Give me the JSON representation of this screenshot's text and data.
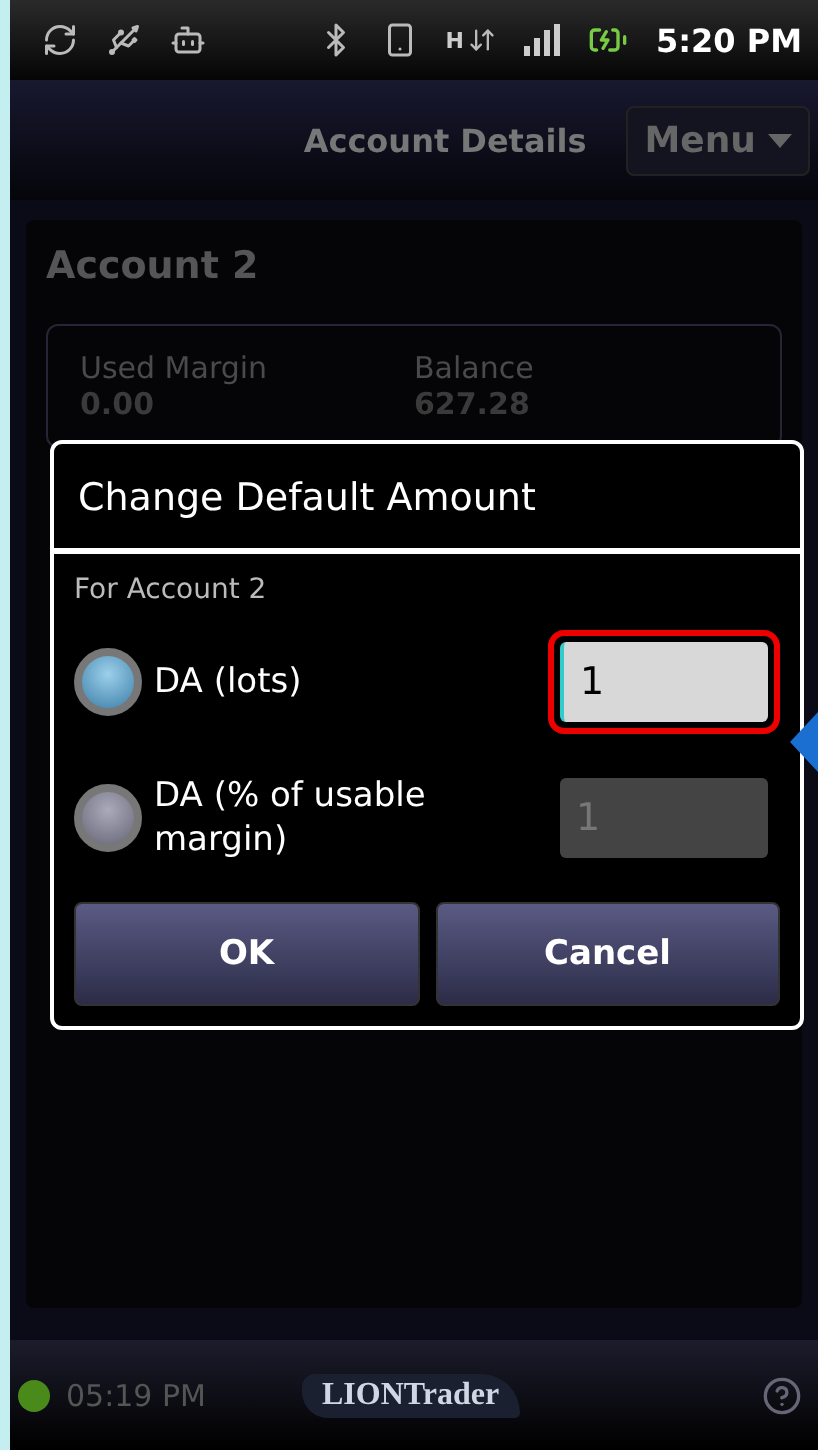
{
  "status_bar": {
    "network": "H",
    "time": "5:20 PM"
  },
  "header": {
    "title": "Account Details",
    "menu": "Menu"
  },
  "account": {
    "name": "Account 2",
    "fields": [
      {
        "label": "Used Margin",
        "value": "0.00"
      },
      {
        "label": "Balance",
        "value": "627.28"
      }
    ]
  },
  "dialog": {
    "title": "Change Default Amount",
    "subtitle": "For Account 2",
    "options": [
      {
        "label": "DA (lots)",
        "selected": true,
        "value": "1",
        "disabled": false,
        "highlighted": true
      },
      {
        "label": "DA (% of usable margin)",
        "selected": false,
        "value": "1",
        "disabled": true,
        "highlighted": false
      }
    ],
    "buttons": [
      "OK",
      "Cancel"
    ]
  },
  "footer": {
    "connected": true,
    "time": "05:19 PM",
    "logo": "LIONTrader"
  }
}
